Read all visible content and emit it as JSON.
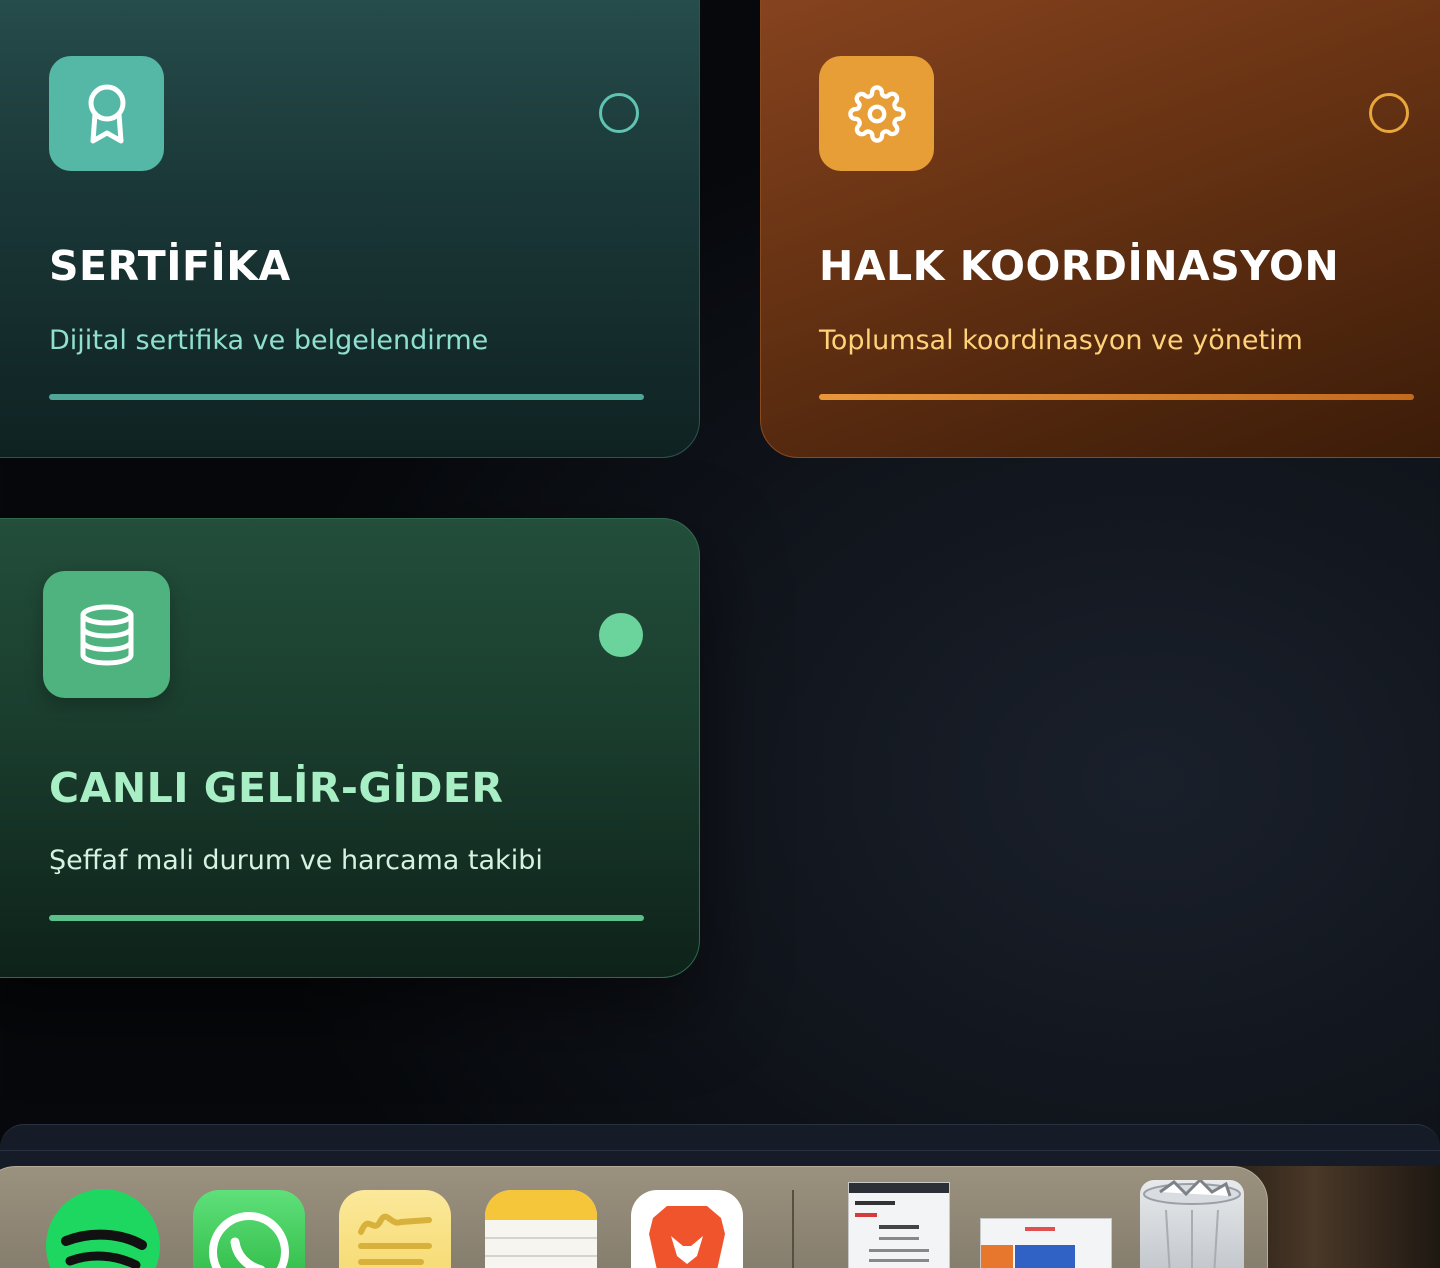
{
  "cards": [
    {
      "id": "sertifika",
      "title": "SERTİFİKA",
      "subtitle": "Dijital sertifika ve belgelendirme",
      "icon": "award-icon",
      "accent": "#55b7a6",
      "selected": false
    },
    {
      "id": "halk-koordinasyon",
      "title": "HALK KOORDİNASYON",
      "subtitle": "Toplumsal koordinasyon ve yönetim",
      "icon": "gear-icon",
      "accent": "#e89e37",
      "selected": false
    },
    {
      "id": "canli-gelir-gider",
      "title": "CANLI GELİR-GİDER",
      "subtitle": "Şeffaf mali durum ve harcama takibi",
      "icon": "database-icon",
      "accent": "#4fb37f",
      "selected": true
    }
  ],
  "dock": {
    "apps": [
      {
        "name": "Spotify",
        "icon": "spotify-icon"
      },
      {
        "name": "WhatsApp",
        "icon": "whatsapp-icon"
      },
      {
        "name": "Freeform",
        "icon": "freeform-icon"
      },
      {
        "name": "Notes",
        "icon": "notes-icon"
      },
      {
        "name": "Brave Browser",
        "icon": "brave-lion-icon"
      }
    ],
    "minimized_windows": 2,
    "trash_icon": "trash-icon"
  }
}
